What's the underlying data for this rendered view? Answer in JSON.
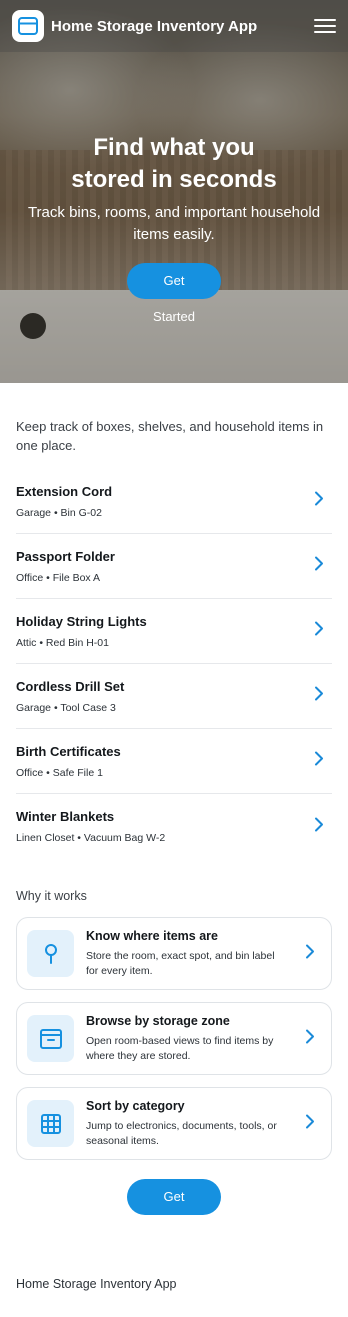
{
  "header": {
    "app_title": "Home Storage Inventory App",
    "logo_icon": "storage-box-icon",
    "menu_icon": "hamburger-menu-icon"
  },
  "hero": {
    "title": "Find what you stored in seconds",
    "subtitle": "Track bins, rooms, and important household items easily.",
    "cta_label": "Get Started"
  },
  "intro": "Keep track of boxes, shelves, and household items in one place.",
  "items": [
    {
      "name": "Extension Cord",
      "location": "Garage • Bin G-02"
    },
    {
      "name": "Passport Folder",
      "location": "Office • File Box A"
    },
    {
      "name": "Holiday String Lights",
      "location": "Attic • Red Bin H-01"
    },
    {
      "name": "Cordless Drill Set",
      "location": "Garage • Tool Case 3"
    },
    {
      "name": "Birth Certificates",
      "location": "Office • Safe File 1"
    },
    {
      "name": "Winter Blankets",
      "location": "Linen Closet • Vacuum Bag W-2"
    }
  ],
  "why": {
    "title": "Why it works",
    "features": [
      {
        "icon": "location-pin-icon",
        "title": "Know where items are",
        "desc": "Store the room, exact spot, and bin label for every item."
      },
      {
        "icon": "storage-box-icon",
        "title": "Browse by storage zone",
        "desc": "Open room-based views to find items by where they are stored."
      },
      {
        "icon": "grid-icon",
        "title": "Sort by category",
        "desc": "Jump to electronics, documents, tools, or seasonal items."
      }
    ]
  },
  "cta_bottom_label": "Get Started",
  "footer": "Home Storage Inventory App",
  "colors": {
    "accent": "#1691e0",
    "icon_bg": "#e3f1fb",
    "chevron": "#1a8ad8"
  }
}
